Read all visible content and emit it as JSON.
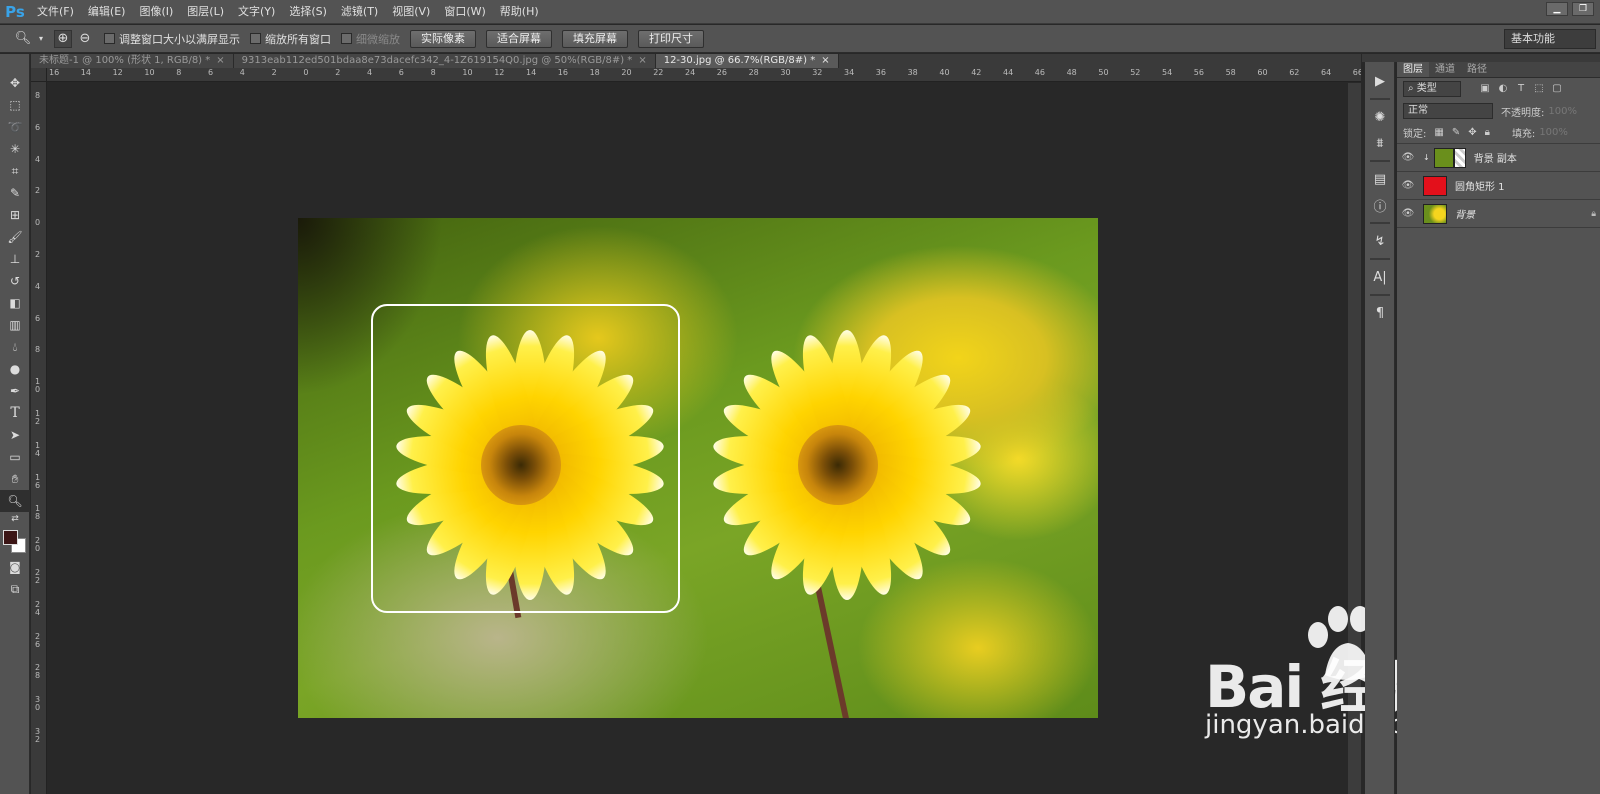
{
  "app": {
    "logo": "Ps",
    "menu": [
      "文件(F)",
      "编辑(E)",
      "图像(I)",
      "图层(L)",
      "文字(Y)",
      "选择(S)",
      "滤镜(T)",
      "视图(V)",
      "窗口(W)",
      "帮助(H)"
    ]
  },
  "options": {
    "check_resize": "调整窗口大小以满屏显示",
    "check_zoom_all": "缩放所有窗口",
    "check_scrubby": "细微缩放",
    "btn_actual": "实际像素",
    "btn_fit": "适合屏幕",
    "btn_fill": "填充屏幕",
    "btn_print": "打印尺寸",
    "workspace": "基本功能"
  },
  "tabs": [
    {
      "label": "未标题-1 @ 100% (形状 1, RGB/8) *",
      "close": "×"
    },
    {
      "label": "9313eab112ed501bdaa8e73dacefc342_4-1Z619154Q0.jpg @ 50%(RGB/8#) *",
      "close": "×"
    },
    {
      "label": "12-30.jpg @ 66.7%(RGB/8#) *",
      "close": "×"
    }
  ],
  "ruler_top": [
    "16",
    "14",
    "12",
    "10",
    "8",
    "6",
    "4",
    "2",
    "0",
    "2",
    "4",
    "6",
    "8",
    "10",
    "12",
    "14",
    "16",
    "18",
    "20",
    "22",
    "24",
    "26",
    "28",
    "30",
    "32",
    "34",
    "36",
    "38",
    "40",
    "42",
    "44",
    "46",
    "48",
    "50",
    "52",
    "54",
    "56",
    "58",
    "60",
    "62",
    "64",
    "66"
  ],
  "ruler_left": [
    "8",
    "6",
    "4",
    "2",
    "0",
    "2",
    "4",
    "6",
    "8",
    "10",
    "12",
    "14",
    "16",
    "18",
    "20",
    "22",
    "24",
    "26",
    "28",
    "30",
    "32"
  ],
  "layers_panel": {
    "tabs": [
      "图层",
      "通道",
      "路径"
    ],
    "filter_label": "类型",
    "blend_mode": "正常",
    "opacity_label": "不透明度:",
    "opacity_value": "100%",
    "lock_label": "锁定:",
    "fill_label": "填充:",
    "fill_value": "100%",
    "layers": [
      {
        "name": "背景 副本",
        "thumb_color": "#6a8f1c"
      },
      {
        "name": "圆角矩形 1",
        "thumb_color": "#e3101b"
      },
      {
        "name": "背景",
        "thumb_color": "#6a8f1c"
      }
    ]
  },
  "watermark": {
    "logo": "Bai  经验",
    "url": "jingyan.baidu.com"
  },
  "colors": {
    "foreground": "#3b1515",
    "background": "#ffffff",
    "accent": "#39a3e8"
  }
}
